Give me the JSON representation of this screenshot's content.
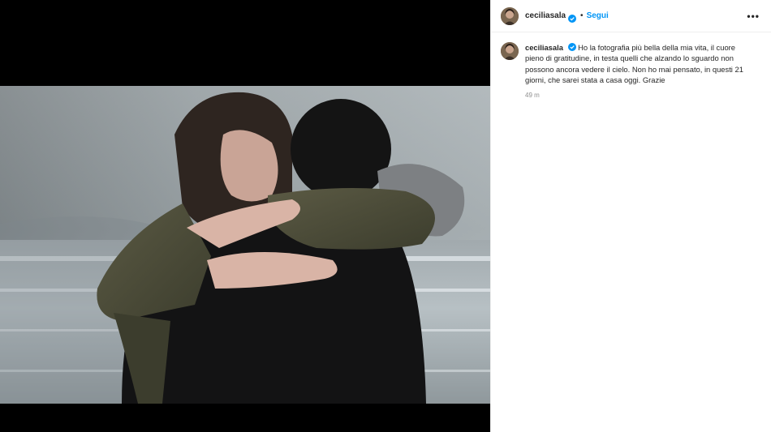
{
  "post": {
    "username": "ceciliasala",
    "follow_label": "Segui",
    "separator": "•",
    "more_label": "•••",
    "caption": "Ho la fotografia più bella della mia vita, il cuore pieno di gratitudine, in testa quelli che alzando lo sguardo non possono ancora vedere il cielo. Non ho mai pensato, in questi 21 giorni, che sarei stata a casa oggi. Grazie",
    "time_ago": "49 m"
  },
  "icons": {
    "verified": "verified-badge-icon",
    "more": "more-options-icon"
  },
  "colors": {
    "follow_blue": "#0095f6",
    "verified_blue": "#0095f6",
    "text": "#262626",
    "muted": "#8e8e8e"
  }
}
